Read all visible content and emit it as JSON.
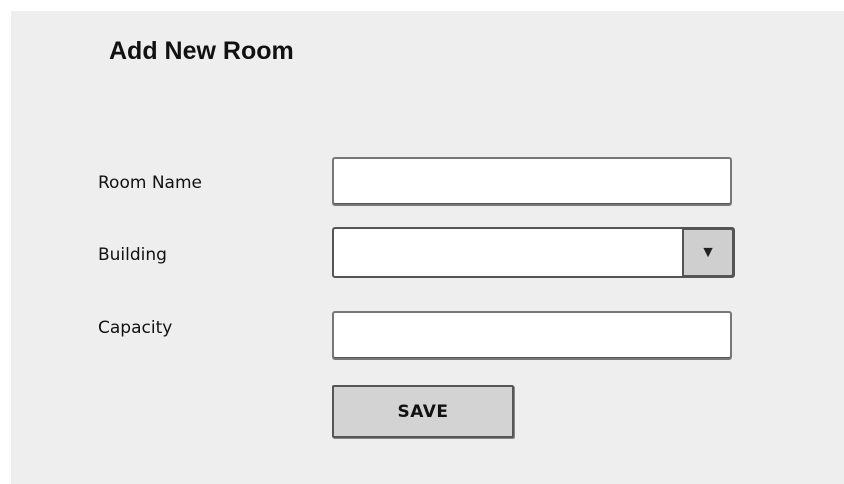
{
  "form": {
    "title": "Add New Room",
    "fields": [
      {
        "label": "Room Name",
        "value": "",
        "type": "text"
      },
      {
        "label": "Building",
        "value": "",
        "type": "select"
      },
      {
        "label": "Capacity",
        "value": "",
        "type": "text"
      }
    ],
    "dropdown_icon": "▼",
    "save_label": "SAVE"
  },
  "icons": {
    "dropdown": "triangle-down-icon"
  },
  "colors": {
    "panel_background": "#eeeeee",
    "button_background": "#d3d3d3",
    "dropdown_button_background": "#cfcfcf",
    "border": "#555555"
  }
}
